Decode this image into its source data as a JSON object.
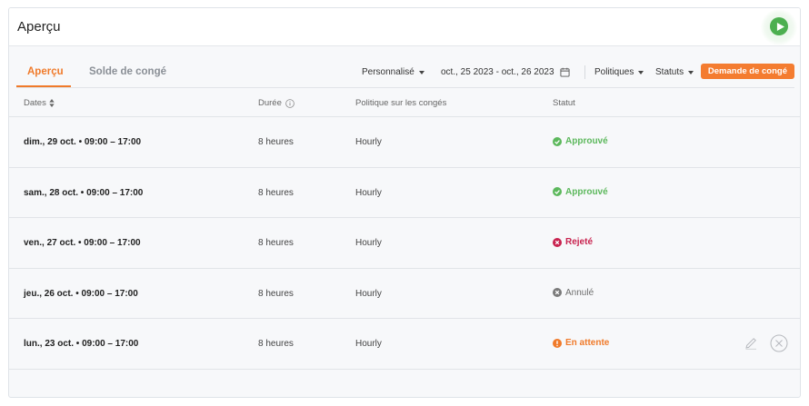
{
  "header": {
    "title": "Aperçu"
  },
  "tabs": [
    {
      "label": "Aperçu",
      "active": true
    },
    {
      "label": "Solde de congé",
      "active": false
    }
  ],
  "filters": {
    "range_preset": "Personnalisé",
    "date_range": "oct., 25 2023 - oct., 26 2023",
    "policies": "Politiques",
    "statuses": "Statuts"
  },
  "request_button": "Demande de congé",
  "table": {
    "columns": [
      "Dates",
      "Durée",
      "Politique sur les congés",
      "Statut"
    ],
    "rows": [
      {
        "date": "dim., 29 oct. • 09:00 – 17:00",
        "duration": "8 heures",
        "policy": "Hourly",
        "status": "Approuvé"
      },
      {
        "date": "sam., 28 oct. • 09:00 – 17:00",
        "duration": "8 heures",
        "policy": "Hourly",
        "status": "Approuvé"
      },
      {
        "date": "ven., 27 oct. • 09:00 – 17:00",
        "duration": "8 heures",
        "policy": "Hourly",
        "status": "Rejeté"
      },
      {
        "date": "jeu., 26 oct. • 09:00 – 17:00",
        "duration": "8 heures",
        "policy": "Hourly",
        "status": "Annulé"
      },
      {
        "date": "lun., 23 oct. • 09:00 – 17:00",
        "duration": "8 heures",
        "policy": "Hourly",
        "status": "En attente"
      }
    ]
  },
  "colors": {
    "accent": "#f07a2a",
    "approved": "#5cb85c",
    "rejected": "#c8234f",
    "cancelled": "#7a7a7a",
    "pending": "#f07a2a",
    "play": "#4caf50"
  },
  "icons": {
    "play": "play-icon",
    "calendar": "calendar-icon",
    "sort": "sort-icon",
    "info": "info-icon",
    "approved": "check-circle-icon",
    "rejected": "x-circle-icon",
    "cancelled": "x-circle-icon",
    "pending": "exclamation-circle-icon",
    "edit": "pencil-icon",
    "cancel": "close-circle-icon"
  }
}
